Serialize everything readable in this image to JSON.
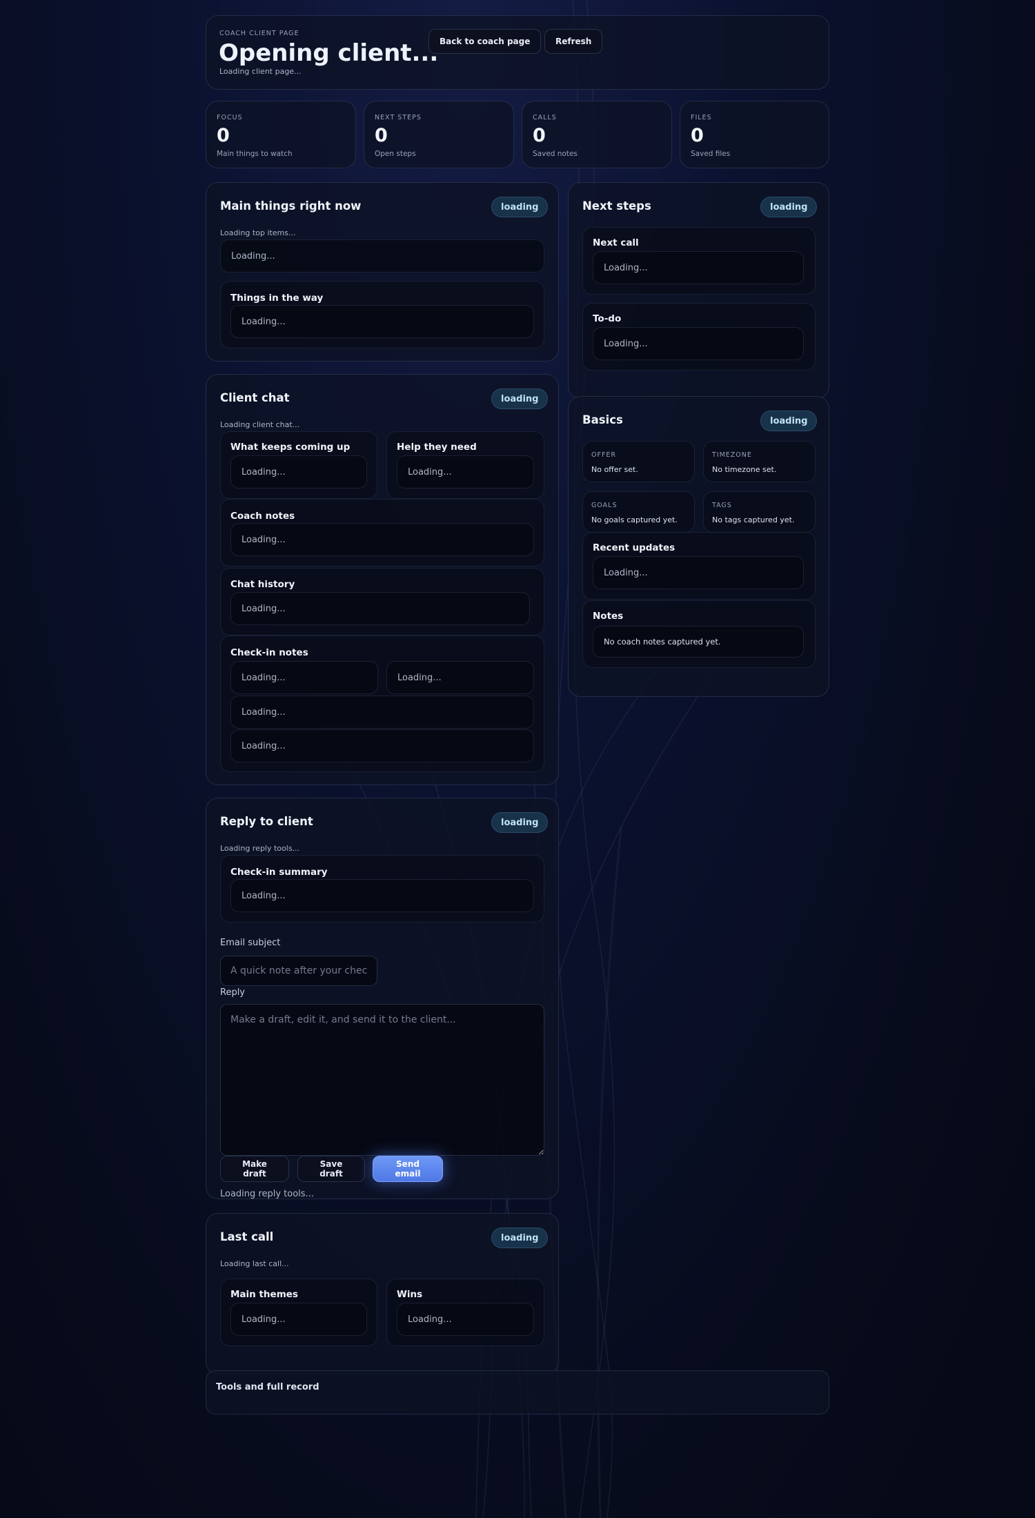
{
  "header": {
    "kicker": "COACH CLIENT PAGE",
    "title": "Opening client...",
    "subtitle": "Loading client page...",
    "back_button": "Back to coach page",
    "refresh_button": "Refresh"
  },
  "stats": [
    {
      "label": "FOCUS",
      "value": "0",
      "sub": "Main things to watch"
    },
    {
      "label": "NEXT STEPS",
      "value": "0",
      "sub": "Open steps"
    },
    {
      "label": "CALLS",
      "value": "0",
      "sub": "Saved notes"
    },
    {
      "label": "FILES",
      "value": "0",
      "sub": "Saved files"
    }
  ],
  "main_things": {
    "title": "Main things right now",
    "badge": "loading",
    "status": "Loading top items...",
    "top_box": "Loading...",
    "blockers_title": "Things in the way",
    "blockers_box": "Loading..."
  },
  "next_steps": {
    "title": "Next steps",
    "badge": "loading",
    "next_call_title": "Next call",
    "next_call_box": "Loading...",
    "todo_title": "To-do",
    "todo_box": "Loading..."
  },
  "client_chat": {
    "title": "Client chat",
    "badge": "loading",
    "status": "Loading client chat...",
    "keeps_title": "What keeps coming up",
    "keeps_box": "Loading...",
    "help_title": "Help they need",
    "help_box": "Loading...",
    "coach_notes_title": "Coach notes",
    "coach_notes_box": "Loading...",
    "history_title": "Chat history",
    "history_box": "Loading...",
    "checkin_title": "Check-in notes",
    "checkin_boxes": [
      "Loading...",
      "Loading...",
      "Loading...",
      "Loading..."
    ]
  },
  "basics": {
    "title": "Basics",
    "badge": "loading",
    "offer_label": "OFFER",
    "offer_value": "No offer set.",
    "timezone_label": "TIMEZONE",
    "timezone_value": "No timezone set.",
    "goals_label": "GOALS",
    "goals_value": "No goals captured yet.",
    "tags_label": "TAGS",
    "tags_value": "No tags captured yet.",
    "updates_title": "Recent updates",
    "updates_box": "Loading...",
    "notes_title": "Notes",
    "notes_box": "No coach notes captured yet."
  },
  "reply": {
    "title": "Reply to client",
    "badge": "loading",
    "status": "Loading reply tools...",
    "summary_title": "Check-in summary",
    "summary_box": "Loading...",
    "subject_label": "Email subject",
    "subject_placeholder": "A quick note after your check-in",
    "reply_label": "Reply",
    "reply_placeholder": "Make a draft, edit it, and send it to the client...",
    "make_draft": "Make draft",
    "save_draft": "Save draft",
    "send_email": "Send email",
    "footer_status": "Loading reply tools..."
  },
  "last_call": {
    "title": "Last call",
    "badge": "loading",
    "status": "Loading last call...",
    "themes_title": "Main themes",
    "themes_box": "Loading...",
    "wins_title": "Wins",
    "wins_box": "Loading..."
  },
  "tools": {
    "title": "Tools and full record"
  }
}
